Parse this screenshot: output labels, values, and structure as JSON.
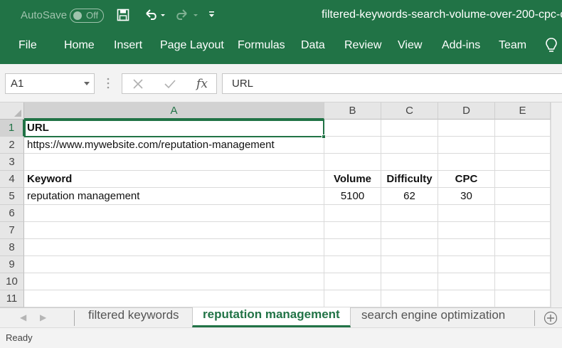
{
  "titlebar": {
    "autosave_label": "AutoSave",
    "autosave_state": "Off",
    "document_title": "filtered-keywords-search-volume-over-200-cpc-ov",
    "icons": [
      "save-icon",
      "undo-icon",
      "redo-icon",
      "customize-qat-icon"
    ]
  },
  "ribbon": {
    "tabs": [
      "File",
      "Home",
      "Insert",
      "Page Layout",
      "Formulas",
      "Data",
      "Review",
      "View",
      "Add-ins",
      "Team"
    ],
    "tell_me_icon": "lightbulb-icon"
  },
  "formula_bar": {
    "name_box": "A1",
    "formula": "URL",
    "fx_label": "fx"
  },
  "grid": {
    "columns": [
      "A",
      "B",
      "C",
      "D",
      "E"
    ],
    "rows": [
      "1",
      "2",
      "3",
      "4",
      "5",
      "6",
      "7",
      "8",
      "9",
      "10",
      "11"
    ],
    "cells": {
      "A1": "URL",
      "A2": "https://www.mywebsite.com/reputation-management",
      "A4": "Keyword",
      "B4": "Volume",
      "C4": "Difficulty",
      "D4": "CPC",
      "A5": "reputation management",
      "B5": "5100",
      "C5": "62",
      "D5": "30"
    },
    "selected_cell": "A1"
  },
  "sheets": {
    "tabs": [
      "filtered keywords",
      "reputation management",
      "search engine optimization"
    ],
    "active": "reputation management"
  },
  "status": {
    "text": "Ready"
  },
  "colors": {
    "excel_green": "#217346"
  }
}
